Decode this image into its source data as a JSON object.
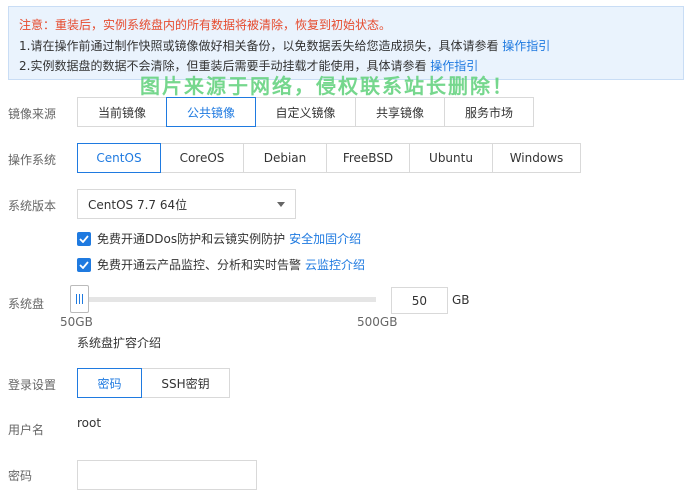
{
  "notice": {
    "line0": "注意：重装后，实例系统盘内的所有数据将被清除，恢复到初始状态。",
    "line1_text": "1.请在操作前通过制作快照或镜像做好相关备份，以免数据丢失给您造成损失，具体请参看",
    "line1_link": "操作指引",
    "line2_text": "2.实例数据盘的数据不会清除，但重装后需要手动挂载才能使用，具体请参看",
    "line2_link": "操作指引"
  },
  "watermark": "图片来源于网络，侵权联系站长删除！",
  "image_source": {
    "label": "镜像来源",
    "options": [
      "当前镜像",
      "公共镜像",
      "自定义镜像",
      "共享镜像",
      "服务市场"
    ],
    "selected": "公共镜像"
  },
  "os": {
    "label": "操作系统",
    "options": [
      "CentOS",
      "CoreOS",
      "Debian",
      "FreeBSD",
      "Ubuntu",
      "Windows"
    ],
    "selected": "CentOS"
  },
  "version": {
    "label": "系统版本",
    "value": "CentOS 7.7 64位"
  },
  "checks": [
    {
      "text": "免费开通DDos防护和云镜实例防护",
      "link": "安全加固介绍",
      "checked": true
    },
    {
      "text": "免费开通云产品监控、分析和实时告警",
      "link": "云监控介绍",
      "checked": true
    }
  ],
  "system_disk": {
    "label": "系统盘",
    "value": "50",
    "unit": "GB",
    "min_label": "50GB",
    "max_label": "500GB",
    "expand_link": "系统盘扩容介绍"
  },
  "login": {
    "label": "登录设置",
    "options": [
      "密码",
      "SSH密钥"
    ],
    "selected": "密码"
  },
  "username": {
    "label": "用户名",
    "value": "root"
  },
  "password": {
    "label": "密码",
    "value": ""
  },
  "colors": {
    "accent": "#1f7ae0",
    "warning": "#e64b2e",
    "notice_bg": "#eaf3fd"
  }
}
